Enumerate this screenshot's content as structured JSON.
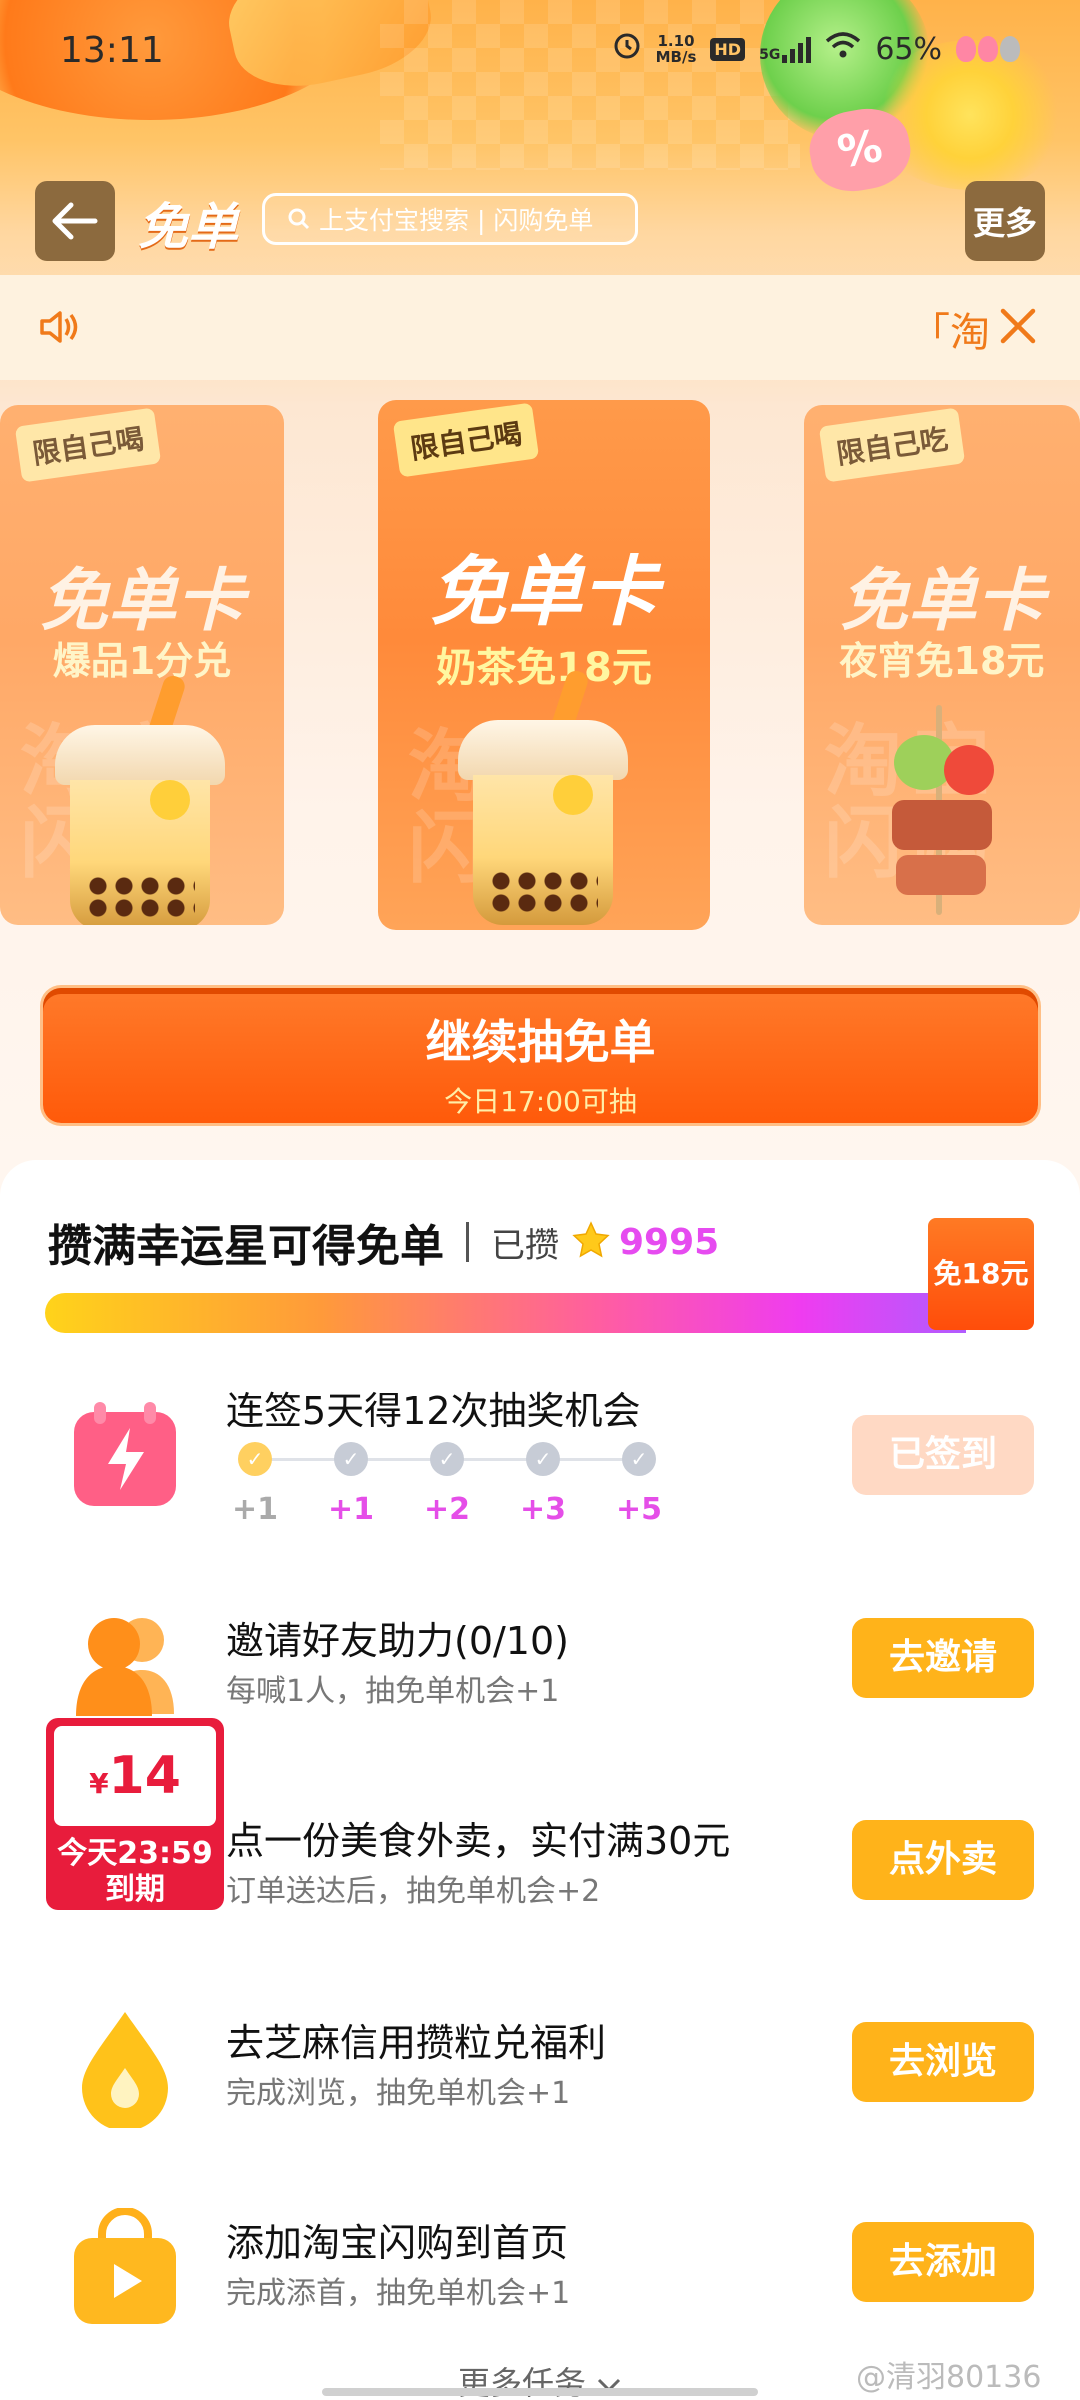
{
  "status_bar": {
    "time": "13:11",
    "net_speed_top": "1.10",
    "net_speed_bottom": "MB/s",
    "hd": "HD",
    "net_type": "5G",
    "battery": "65%"
  },
  "nav": {
    "title": "免单",
    "search_placeholder": "上支付宝搜索 | 闪购免单",
    "more_label": "更多"
  },
  "notice": {
    "marquee_text": "「淘宝"
  },
  "cards": [
    {
      "tag": "限自己喝",
      "title": "免单卡",
      "subtitle": "爆品1分兑",
      "watermark": "淘宝 闪购"
    },
    {
      "tag": "限自己喝",
      "title": "免单卡",
      "subtitle": "奶茶免18元",
      "watermark": "淘宝 闪购"
    },
    {
      "tag": "限自己吃",
      "title": "免单卡",
      "subtitle": "夜宵免18元",
      "watermark": "淘宝 闪购"
    }
  ],
  "cta": {
    "label": "继续抽免单",
    "sub_label": "今日17:00可抽"
  },
  "panel": {
    "title": "攒满幸运星可得免单",
    "collected_label": "已攒",
    "collected_count": "9995",
    "progress_fraction": 0.93,
    "reward_label": "免18元"
  },
  "tasks": [
    {
      "title": "连签5天得12次抽奖机会",
      "desc": "",
      "button": "已签到",
      "steps": [
        "+1",
        "+1",
        "+2",
        "+3",
        "+5"
      ]
    },
    {
      "title": "邀请好友助力(0/10)",
      "desc": "每喊1人，抽免单机会+1",
      "button": "去邀请"
    },
    {
      "title": "点一份美食外卖，实付满30元",
      "desc": "订单送达后，抽免单机会+2",
      "button": "点外卖"
    },
    {
      "title": "去芝麻信用攒粒兑福利",
      "desc": "完成浏览，抽免单机会+1",
      "button": "去浏览"
    },
    {
      "title": "添加淘宝闪购到首页",
      "desc": "完成添首，抽免单机会+1",
      "button": "去添加"
    }
  ],
  "coupon": {
    "currency": "¥",
    "amount": "14",
    "expiry_line1": "今天23:59",
    "expiry_line2": "到期"
  },
  "footer": {
    "more_tasks": "更多任务",
    "watermark": "@清羽80136"
  },
  "colors": {
    "accent_orange": "#ff5a0a",
    "task_button": "#ffb31a",
    "star_count": "#e64bf0"
  }
}
